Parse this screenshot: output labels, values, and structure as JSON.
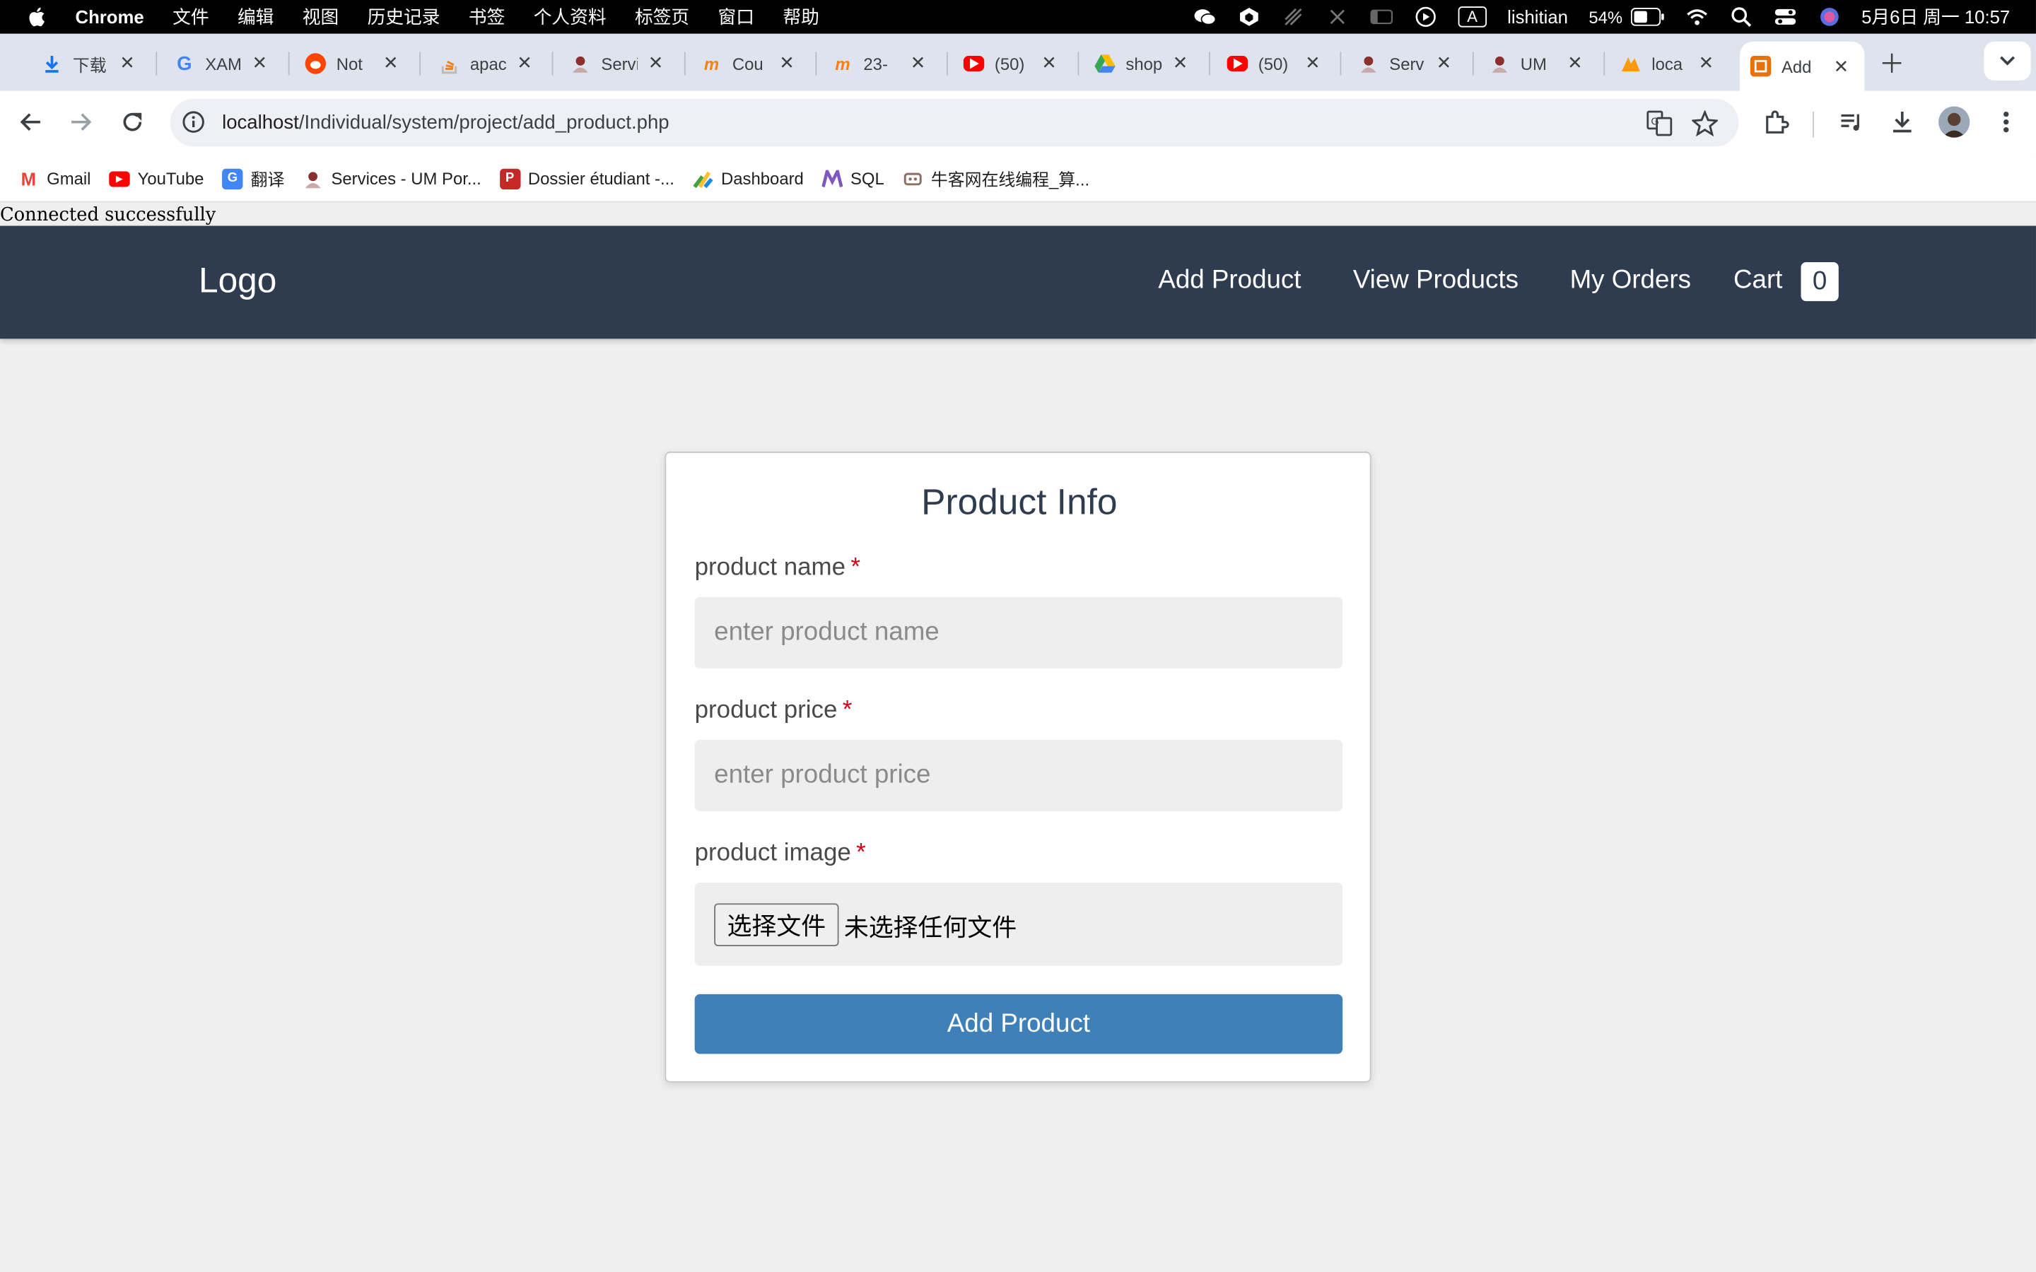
{
  "menubar": {
    "app": "Chrome",
    "items": [
      "文件",
      "编辑",
      "视图",
      "历史记录",
      "书签",
      "个人资料",
      "标签页",
      "窗口",
      "帮助"
    ],
    "input_source": "A",
    "user": "lishitian",
    "battery": "54%",
    "datetime": "5月6日 周一  10:57"
  },
  "tabs": [
    {
      "title": "下载",
      "icon": "download-icon",
      "color": "#1a73e8"
    },
    {
      "title": "XAMPP",
      "icon": "google-icon",
      "color": "#4285f4"
    },
    {
      "title": "Not",
      "icon": "reddit-icon",
      "color": "#ff4500"
    },
    {
      "title": "apache",
      "icon": "stackoverflow-icon",
      "color": "#f48024"
    },
    {
      "title": "Services",
      "icon": "um-icon",
      "color": "#8b2e2e"
    },
    {
      "title": "Cou",
      "icon": "moodle-icon",
      "color": "#f98012"
    },
    {
      "title": "23-",
      "icon": "moodle-icon",
      "color": "#f98012"
    },
    {
      "title": "(50)",
      "icon": "youtube-icon",
      "color": "#ff0000"
    },
    {
      "title": "shop",
      "icon": "drive-icon",
      "color": "#34a853"
    },
    {
      "title": "(50)",
      "icon": "youtube-icon",
      "color": "#ff0000"
    },
    {
      "title": "Serv",
      "icon": "um-icon",
      "color": "#8b2e2e"
    },
    {
      "title": "UM",
      "icon": "um-icon",
      "color": "#8b2e2e"
    },
    {
      "title": "loca",
      "icon": "phpmyadmin-icon",
      "color": "#f89c0e"
    },
    {
      "title": "Add",
      "icon": "app-icon",
      "color": "#e8710a",
      "active": true
    }
  ],
  "omnibox": {
    "host": "localhost",
    "path": "/Individual/system/project/add_product.php"
  },
  "bookmarks": [
    {
      "label": "Gmail",
      "icon": "gmail-icon",
      "color": "#ea4335",
      "glyph": "M"
    },
    {
      "label": "YouTube",
      "icon": "youtube-icon",
      "color": "#ff0000",
      "glyph": "▶"
    },
    {
      "label": "翻译",
      "icon": "translate-icon",
      "color": "#4285f4",
      "glyph": "G"
    },
    {
      "label": "Services - UM Por...",
      "icon": "um-icon",
      "color": "#8b2e2e",
      "glyph": "•"
    },
    {
      "label": "Dossier étudiant -...",
      "icon": "dossier-icon",
      "color": "#c62828",
      "glyph": "P"
    },
    {
      "label": "Dashboard",
      "icon": "dashboard-icon",
      "color": "#43a047",
      "glyph": "/"
    },
    {
      "label": "SQL",
      "icon": "sql-icon",
      "color": "#7e57c2",
      "glyph": "M"
    },
    {
      "label": "牛客网在线编程_算...",
      "icon": "nowcoder-icon",
      "color": "#8d6e63",
      "glyph": "◦"
    }
  ],
  "page": {
    "status": "Connected successfully",
    "logo": "Logo",
    "nav": [
      "Add Product",
      "View Products",
      "My Orders",
      "Cart"
    ],
    "cart_count": "0",
    "form": {
      "title": "Product Info",
      "name_label": "product name",
      "name_placeholder": "enter product name",
      "price_label": "product price",
      "price_placeholder": "enter product price",
      "image_label": "product image",
      "required_mark": "*",
      "file_button": "选择文件",
      "file_status": "未选择任何文件",
      "submit": "Add Product"
    }
  },
  "colors": {
    "navbar": "#2f3c4f",
    "submit": "#4080b8",
    "required": "#d0021b",
    "page_bg": "#efefef"
  }
}
